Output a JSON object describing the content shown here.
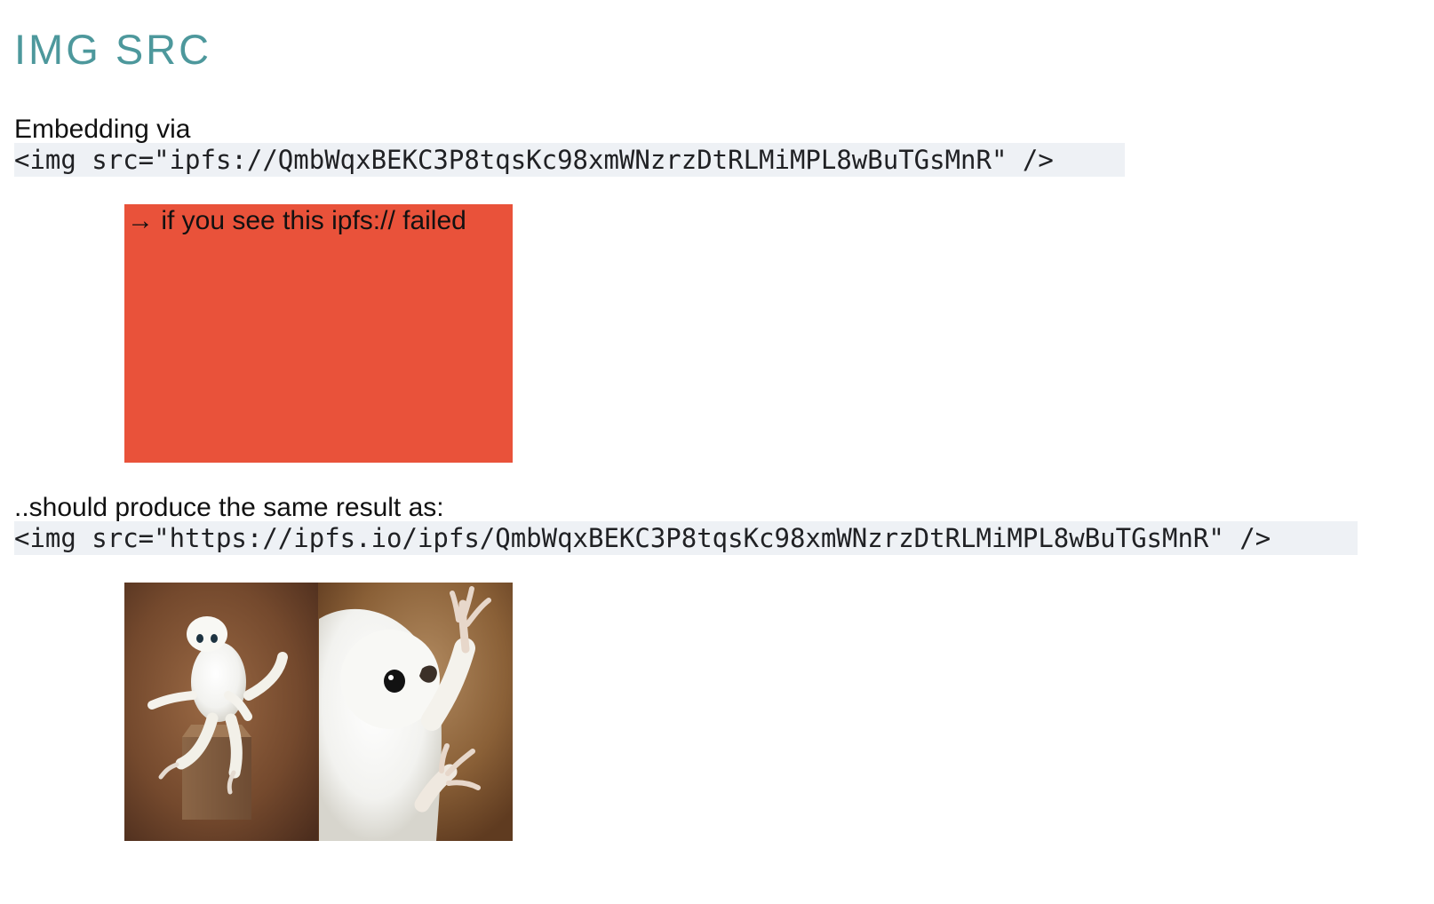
{
  "page": {
    "title": "IMG SRC",
    "intro_text": "Embedding via",
    "code_ipfs": "<img src=\"ipfs://QmbWqxBEKC3P8tqsKc98xmWNzrzDtRLMiMPL8wBuTGsMnR\" />",
    "failed_message": "→ if you see this ipfs:// failed",
    "second_text": "..should produce the same result as:",
    "code_gateway": "<img src=\"https://ipfs.io/ipfs/QmbWqxBEKC3P8tqsKc98xmWNzrzDtRLMiMPL8wBuTGsMnR\" />"
  },
  "colors": {
    "title": "#4d989c",
    "code_background": "#eef1f5",
    "failed_box": "#e9523a",
    "meme_left_background": "#74492d",
    "meme_right_background": "#8a6037"
  },
  "images": {
    "meme_image": "confused-white-creature-meme"
  }
}
